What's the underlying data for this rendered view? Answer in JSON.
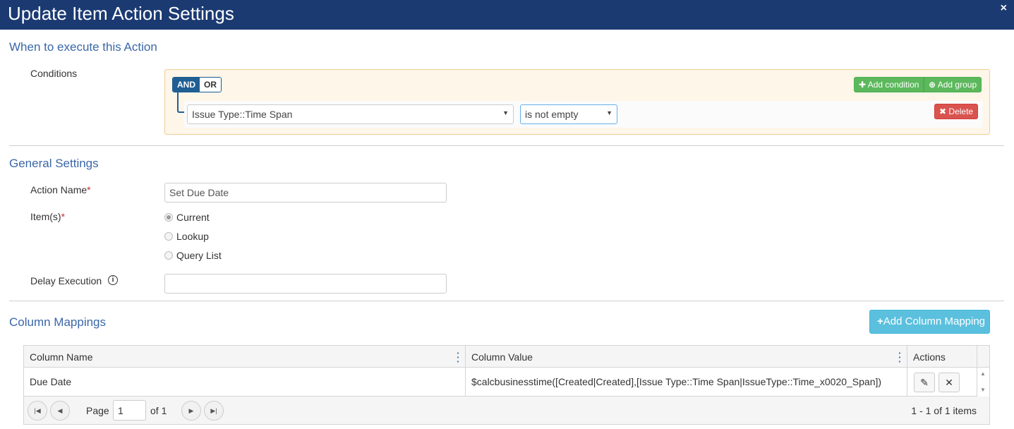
{
  "dialog": {
    "title": "Update Item Action Settings",
    "close_icon": "×"
  },
  "when": {
    "section_title": "When to execute this Action",
    "conditions_label": "Conditions",
    "and_label": "AND",
    "or_label": "OR",
    "add_condition_label": "Add condition",
    "add_group_label": "Add group",
    "field_select_value": "Issue Type::Time Span",
    "operator_select_value": "is not empty",
    "delete_label": "Delete"
  },
  "general": {
    "section_title": "General Settings",
    "action_name_label": "Action Name",
    "action_name_value": "Set Due Date",
    "items_label": "Item(s)",
    "items_options": [
      "Current",
      "Lookup",
      "Query List"
    ],
    "items_selected": "Current",
    "delay_label": "Delay Execution",
    "delay_value": ""
  },
  "mappings": {
    "section_title": "Column Mappings",
    "add_button_label": "Add Column Mapping",
    "columns": [
      "Column Name",
      "Column Value",
      "Actions"
    ],
    "rows": [
      {
        "name": "Due Date",
        "value": "$calcbusinesstime([Created|Created],[Issue Type::Time Span|IssueType::Time_x0020_Span])"
      }
    ],
    "pager": {
      "page_label": "Page",
      "page_value": "1",
      "of_label": "of 1",
      "summary": "1 - 1 of 1 items"
    }
  },
  "colors": {
    "titlebar": "#1b3a72",
    "section_title": "#3a67a8",
    "green": "#5cb85c",
    "red": "#d9534f",
    "info": "#5bc0de"
  }
}
